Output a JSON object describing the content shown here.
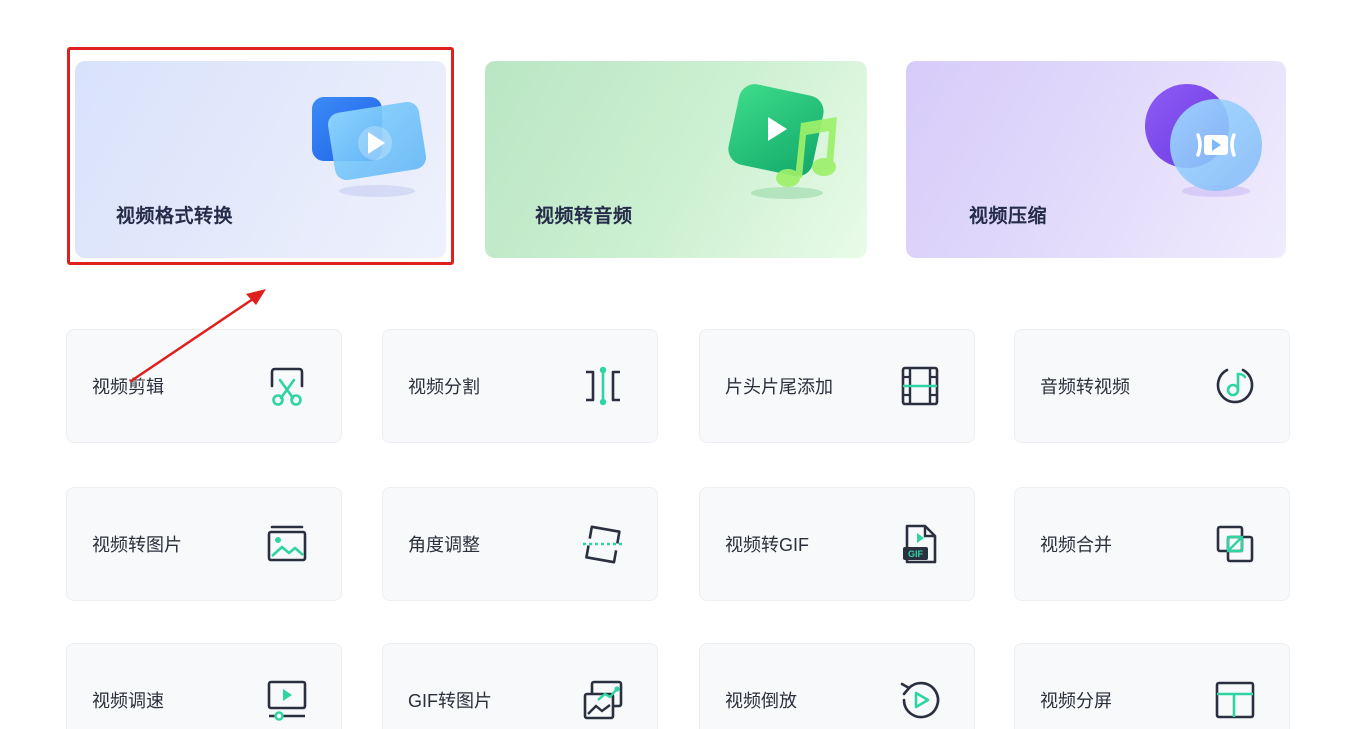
{
  "features": [
    {
      "title": "视频格式转换"
    },
    {
      "title": "视频转音频"
    },
    {
      "title": "视频压缩"
    }
  ],
  "tools": [
    {
      "label": "视频剪辑",
      "icon": "scissors-screen-icon"
    },
    {
      "label": "视频分割",
      "icon": "split-icon"
    },
    {
      "label": "片头片尾添加",
      "icon": "film-strip-icon"
    },
    {
      "label": "音频转视频",
      "icon": "music-note-circle-icon"
    },
    {
      "label": "视频转图片",
      "icon": "image-icon"
    },
    {
      "label": "角度调整",
      "icon": "rotate-frame-icon"
    },
    {
      "label": "视频转GIF",
      "icon": "gif-file-icon"
    },
    {
      "label": "视频合并",
      "icon": "merge-squares-icon"
    },
    {
      "label": "视频调速",
      "icon": "speed-screen-icon"
    },
    {
      "label": "GIF转图片",
      "icon": "gif-image-icon"
    },
    {
      "label": "视频倒放",
      "icon": "reverse-play-icon"
    },
    {
      "label": "视频分屏",
      "icon": "split-screen-icon"
    }
  ],
  "colors": {
    "accent": "#2fd4a3",
    "icon_stroke": "#2b3040",
    "highlight": "#e0201d"
  }
}
